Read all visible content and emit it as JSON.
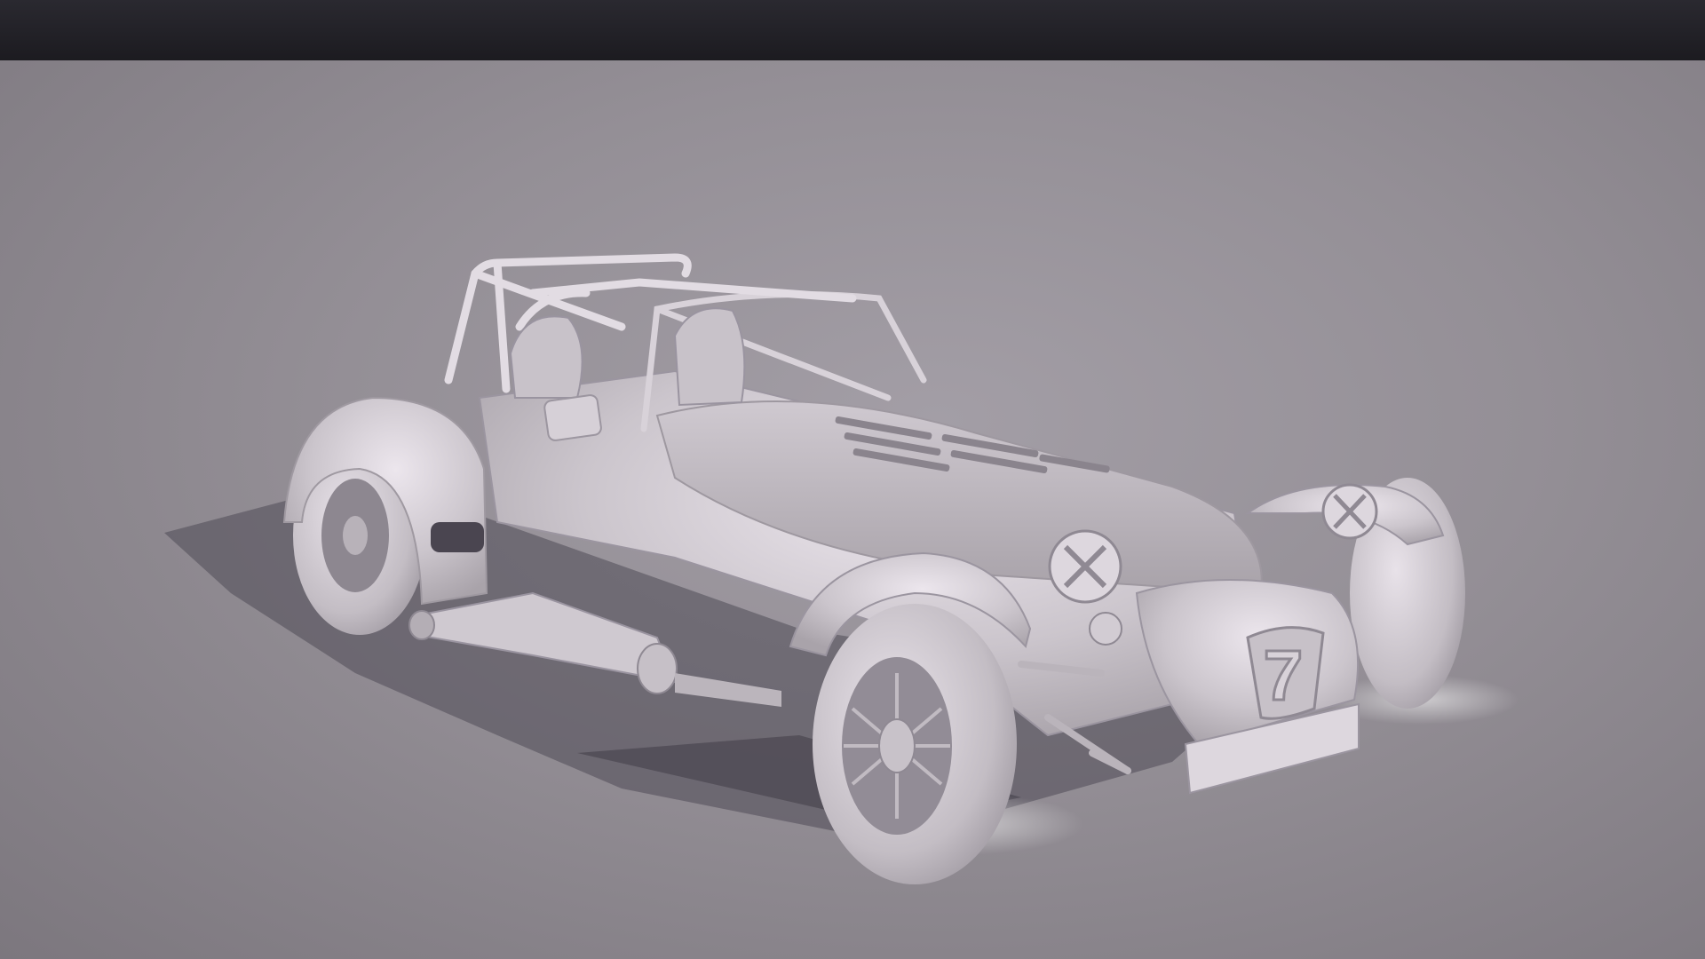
{
  "scene": {
    "subject": "car-render",
    "badge_text": "7",
    "colors": {
      "top_bar": "#1f1e24",
      "floor": "#948f96",
      "body": "#d9d3da",
      "shadow": "#5a5560"
    }
  }
}
